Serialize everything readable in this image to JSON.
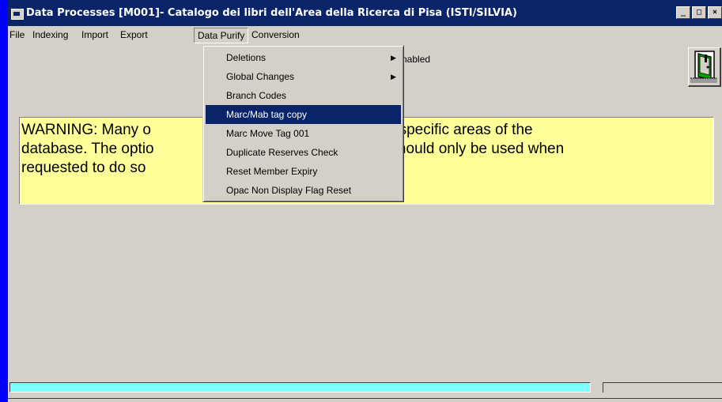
{
  "window": {
    "title": "Data Processes  [M001]- Catalogo dei libri dell'Area della Ricerca di Pisa  (ISTI/SILVIA)",
    "controls": {
      "minimize": "_",
      "maximize": "□",
      "close": "×"
    }
  },
  "menubar": {
    "items": [
      "File",
      "Indexing",
      "Import",
      "Export",
      "Data Purify",
      "Conversion"
    ]
  },
  "dropdown": {
    "items": [
      {
        "label": "Deletions",
        "submenu": true
      },
      {
        "label": "Global Changes",
        "submenu": true
      },
      {
        "label": "Branch Codes",
        "submenu": false
      },
      {
        "label": "Marc/Mab tag copy",
        "submenu": false
      },
      {
        "label": "Marc Move Tag 001",
        "submenu": false
      },
      {
        "label": "Duplicate Reserves Check",
        "submenu": false
      },
      {
        "label": "Reset Member Expiry",
        "submenu": false
      },
      {
        "label": "Opac Non Display Flag Reset",
        "submenu": false
      }
    ],
    "selected_index": 3,
    "arrow_glyph": "▶"
  },
  "status": {
    "text": "Enabled"
  },
  "warning": {
    "line1_left": "WARNING:   Many o",
    "line1_right": "change specific areas of the",
    "line2_left": "database.  The optio",
    "line2_right": "menu should only be used when",
    "line3_left": "requested to do so",
    "line3_right": "."
  },
  "progress": {
    "primary_fill": 1.0
  },
  "colors": {
    "desktop": "#0000fe",
    "titlebar": "#0a246a",
    "warning_bg": "#ffff99",
    "progress_fill": "#80ffff",
    "selection": "#0a246a"
  },
  "icons": {
    "app": "app-window-icon",
    "exit": "exit-door-icon"
  }
}
